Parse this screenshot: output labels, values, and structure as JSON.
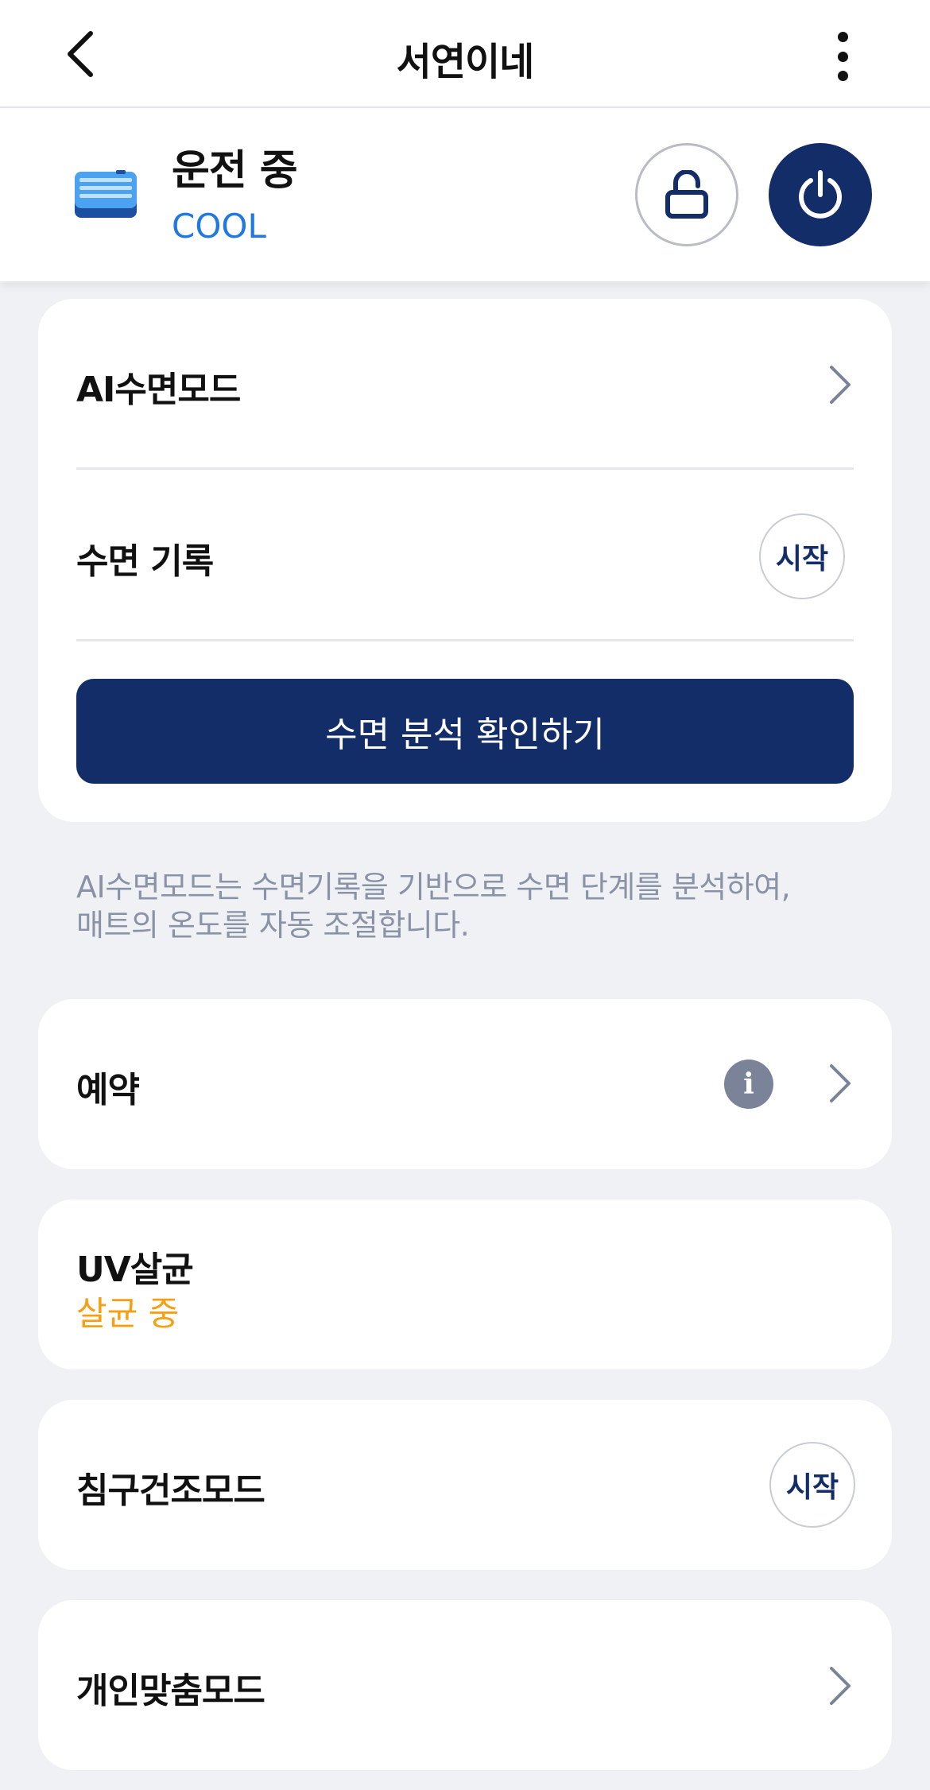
{
  "header": {
    "title": "서연이네",
    "back_icon": "chevron-left-icon",
    "more_icon": "more-vertical-icon"
  },
  "status": {
    "title": "운전 중",
    "mode": "COOL",
    "device_icon": "mattress-icon",
    "lock_icon": "unlock-icon",
    "power_icon": "power-icon",
    "colors": {
      "mode": "#1f79e0",
      "power_bg": "#132d69"
    }
  },
  "sleep_card": {
    "ai_sleep_label": "AI수면모드",
    "sleep_record_label": "수면 기록",
    "sleep_record_button": "시작",
    "analysis_button": "수면 분석 확인하기"
  },
  "helper_text": {
    "line1": "AI수면모드는 수면기록을 기반으로 수면 단계를 분석하여,",
    "line2": "매트의 온도를 자동 조절합니다."
  },
  "reservation": {
    "label": "예약",
    "info_icon": "info-icon",
    "info_glyph": "i"
  },
  "uv": {
    "label": "UV살균",
    "status": "살균 중",
    "status_color": "#f5a012"
  },
  "bedding_dry": {
    "label": "침구건조모드",
    "button": "시작"
  },
  "custom_mode": {
    "label": "개인맞춤모드"
  }
}
